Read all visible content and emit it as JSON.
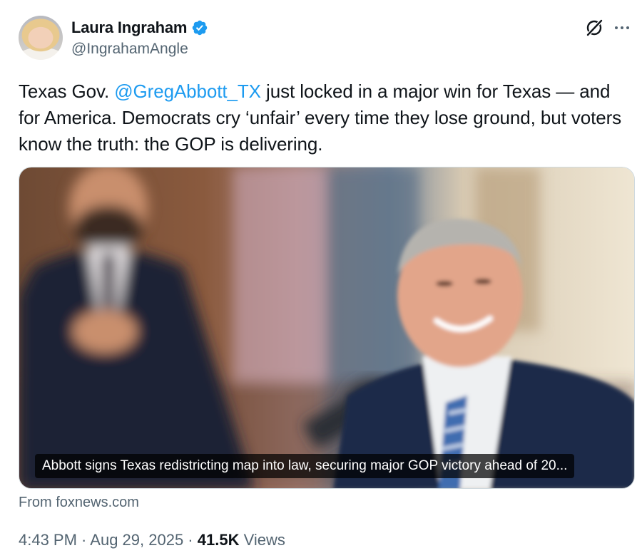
{
  "author": {
    "display_name": "Laura Ingraham",
    "handle": "@IngrahamAngle",
    "verified": true,
    "avatar_icon": "profile-photo"
  },
  "header_actions": {
    "grok_icon": "grok-icon",
    "more_icon": "more-options-icon"
  },
  "tweet": {
    "text_before": "Texas Gov. ",
    "mention": "@GregAbbott_TX",
    "text_after": "  just locked in a major win for Texas — and for America. Democrats cry ‘unfair’ every time they lose ground, but voters know the truth: the GOP is delivering."
  },
  "link_card": {
    "caption": "Abbott signs Texas redistricting map into law, securing major GOP victory ahead of 20...",
    "source": "From foxnews.com"
  },
  "meta": {
    "time": "4:43 PM",
    "separator": " · ",
    "date": "Aug 29, 2025",
    "views_count": "41.5K",
    "views_label": " Views"
  },
  "colors": {
    "accent": "#1d9bf0",
    "text": "#0f1419",
    "secondary_text": "#536471",
    "border": "#cfd9de"
  }
}
